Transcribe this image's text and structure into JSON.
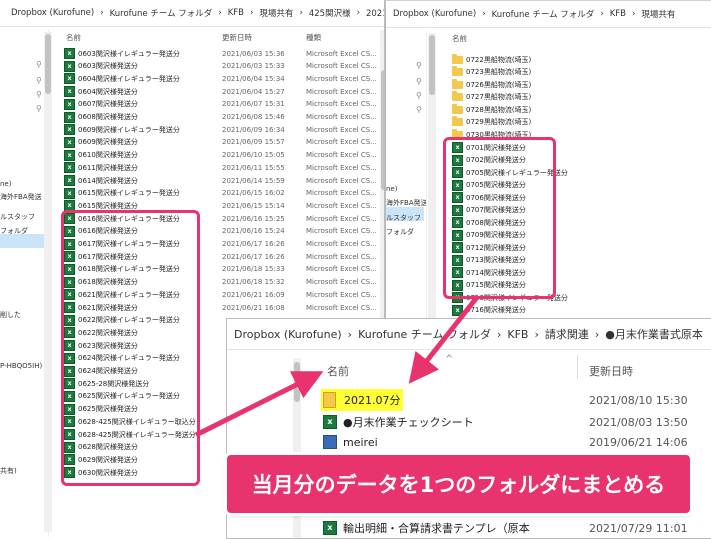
{
  "win1": {
    "breadcrumb": [
      "Dropbox (Kurofune)",
      "›",
      "Kurofune チーム フォルダ",
      "›",
      "KFB",
      "›",
      "現場共有",
      "›",
      "425関沢様",
      "›",
      "2021-06月"
    ],
    "columns": {
      "name": "名前",
      "date": "更新日時",
      "type": "種類"
    },
    "nav": [
      "ne)",
      "海外FBA発送",
      "ルスタッフ",
      "フォルダ",
      "削した",
      "P-HBQO5IH)",
      "共有)"
    ],
    "rows": [
      {
        "name": "0603関沢様イレギュラー発送分",
        "date": "2021/06/03 15:36",
        "type": "Microsoft Excel CS..."
      },
      {
        "name": "0603関沢様発送分",
        "date": "2021/06/03 15:33",
        "type": "Microsoft Excel CS..."
      },
      {
        "name": "0604関沢様イレギュラー発送分",
        "date": "2021/06/04 15:34",
        "type": "Microsoft Excel CS..."
      },
      {
        "name": "0604関沢様発送分",
        "date": "2021/06/04 15:27",
        "type": "Microsoft Excel CS..."
      },
      {
        "name": "0607関沢様発送分",
        "date": "2021/06/07 15:31",
        "type": "Microsoft Excel CS..."
      },
      {
        "name": "0608関沢様発送分",
        "date": "2021/06/08 15:46",
        "type": "Microsoft Excel CS..."
      },
      {
        "name": "0609関沢様イレギュラー発送分",
        "date": "2021/06/09 16:34",
        "type": "Microsoft Excel CS..."
      },
      {
        "name": "0609関沢様発送分",
        "date": "2021/06/09 15:57",
        "type": "Microsoft Excel CS..."
      },
      {
        "name": "0610関沢様発送分",
        "date": "2021/06/10 15:05",
        "type": "Microsoft Excel CS..."
      },
      {
        "name": "0611関沢様発送分",
        "date": "2021/06/11 15:55",
        "type": "Microsoft Excel CS..."
      },
      {
        "name": "0614関沢様発送分",
        "date": "2021/06/14 15:59",
        "type": "Microsoft Excel CS..."
      },
      {
        "name": "0615関沢様イレギュラー発送分",
        "date": "2021/06/15 16:02",
        "type": "Microsoft Excel CS..."
      },
      {
        "name": "0615関沢様発送分",
        "date": "2021/06/15 15:14",
        "type": "Microsoft Excel CS..."
      },
      {
        "name": "0616関沢様イレギュラー発送分",
        "date": "2021/06/16 15:25",
        "type": "Microsoft Excel CS..."
      },
      {
        "name": "0616関沢様発送分",
        "date": "2021/06/16 15:24",
        "type": "Microsoft Excel CS..."
      },
      {
        "name": "0617関沢様イレギュラー発送分",
        "date": "2021/06/17 16:26",
        "type": "Microsoft Excel CS..."
      },
      {
        "name": "0617関沢様発送分",
        "date": "2021/06/17 16:26",
        "type": "Microsoft Excel CS..."
      },
      {
        "name": "0618関沢様イレギュラー発送分",
        "date": "2021/06/18 15:33",
        "type": "Microsoft Excel CS..."
      },
      {
        "name": "0618関沢様発送分",
        "date": "2021/06/18 15:32",
        "type": "Microsoft Excel CS..."
      },
      {
        "name": "0621関沢様イレギュラー発送分",
        "date": "2021/06/21 16:09",
        "type": "Microsoft Excel CS..."
      },
      {
        "name": "0621関沢様発送分",
        "date": "2021/06/21 16:08",
        "type": "Microsoft Excel CS..."
      },
      {
        "name": "0622関沢様イレギュラー発送分",
        "date": "",
        "type": ""
      },
      {
        "name": "0622関沢様発送分",
        "date": "",
        "type": ""
      },
      {
        "name": "0623関沢様発送分",
        "date": "",
        "type": ""
      },
      {
        "name": "0624関沢様イレギュラー発送分",
        "date": "",
        "type": ""
      },
      {
        "name": "0624関沢様発送分",
        "date": "",
        "type": ""
      },
      {
        "name": "0625-28関沢様発送分",
        "date": "",
        "type": ""
      },
      {
        "name": "0625関沢様イレギュラー発送分",
        "date": "",
        "type": ""
      },
      {
        "name": "0625関沢様発送分",
        "date": "",
        "type": ""
      },
      {
        "name": "0628-425関沢様イレギュラー取込分",
        "date": "",
        "type": ""
      },
      {
        "name": "0628-425関沢様イレギュラー発送分",
        "date": "",
        "type": ""
      },
      {
        "name": "0628関沢様発送分",
        "date": "",
        "type": ""
      },
      {
        "name": "0629関沢様発送分",
        "date": "",
        "type": ""
      },
      {
        "name": "0630関沢様発送分",
        "date": "",
        "type": ""
      }
    ]
  },
  "win2": {
    "breadcrumb": [
      "Dropbox (Kurofune)",
      "›",
      "Kurofune チーム フォルダ",
      "›",
      "KFB",
      "›",
      "現場共有"
    ],
    "columns": {
      "name": "名前"
    },
    "nav": [
      "ne)",
      "海外FBA発送",
      "ルスタッフ",
      "フォルダ"
    ],
    "folders": [
      "0722黒船物流(埼玉)",
      "0723黒船物流(埼玉)",
      "0726黒船物流(埼玉)",
      "0727黒船物流(埼玉)",
      "0728黒船物流(埼玉)",
      "0729黒船物流(埼玉)",
      "0730黒船物流(埼玉)"
    ],
    "rows": [
      "0701関沢様発送分",
      "0702関沢様発送分",
      "0705関沢様イレギュラー発送分",
      "0705関沢様発送分",
      "0706関沢様発送分",
      "0707関沢様発送分",
      "0708関沢様発送分",
      "0709関沢様発送分",
      "0712関沢様発送分",
      "0713関沢様発送分",
      "0714関沢様発送分",
      "0715関沢様発送分",
      "0716関沢様イレギュラー発送分",
      "0716関沢様発送分"
    ]
  },
  "win3": {
    "breadcrumb": [
      "Dropbox (Kurofune)",
      "›",
      "Kurofune チーム フォルダ",
      "›",
      "KFB",
      "›",
      "請求関連",
      "›",
      "●月末作業書式原本"
    ],
    "columns": {
      "name": "名前",
      "date": "更新日時"
    },
    "rows": [
      {
        "icon": "folder",
        "name": "2021.07分",
        "date": "2021/08/10 15:30"
      },
      {
        "icon": "xls",
        "name": "●月末作業チェックシート",
        "date": "2021/08/03 13:50"
      },
      {
        "icon": "doc",
        "name": "meirei",
        "date": "2019/06/21 14:06"
      },
      {
        "icon": "xls",
        "name": "輸出明細・合算請求書テンプレ（原本",
        "date": "2021/07/29 11:01"
      }
    ]
  },
  "banner": {
    "text": "当月分のデータを1つのフォルダにまとめる"
  },
  "colors": {
    "highlight": "#e8336d",
    "banner": "#e8336d",
    "folder_highlight": "#ffff33"
  }
}
